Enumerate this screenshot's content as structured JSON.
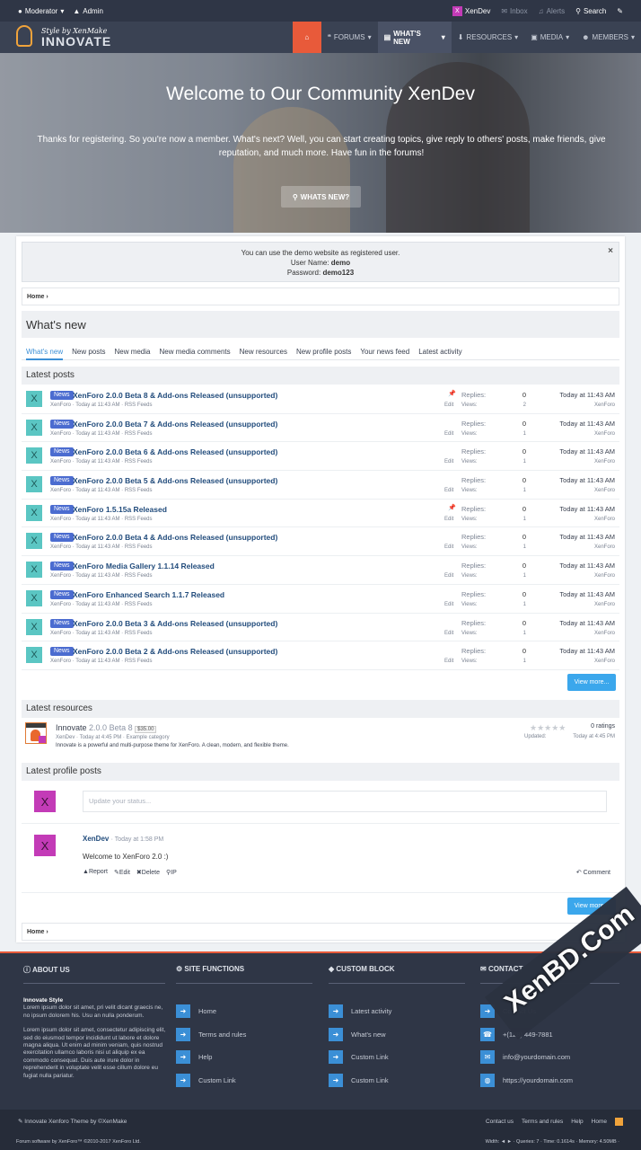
{
  "topbar": {
    "left": [
      {
        "icon": "user-icon",
        "label": "Moderator"
      },
      {
        "icon": "lock-icon",
        "label": "Admin"
      }
    ],
    "user": {
      "avatar": "X",
      "name": "XenDev"
    },
    "inbox": "Inbox",
    "alerts": "Alerts",
    "search": "Search"
  },
  "logo": {
    "tagline": "Style by XenMake",
    "name": "INNOVATE"
  },
  "nav": {
    "home_icon": "home-icon",
    "tabs": [
      "FORUMS",
      "WHAT'S NEW",
      "RESOURCES",
      "MEDIA",
      "MEMBERS"
    ]
  },
  "hero": {
    "title": "Welcome to Our Community XenDev",
    "text": "Thanks for registering. So you're now a member. What's next? Well, you can start creating topics, give reply to others' posts, make friends, give reputation, and much more. Have fun in the forums!",
    "button": "WHATS NEW?"
  },
  "notice": {
    "line1": "You can use the demo website as registered user.",
    "user_label": "User Name:",
    "user_value": "demo",
    "pass_label": "Password:",
    "pass_value": "demo123",
    "close": "×"
  },
  "breadcrumb": {
    "home": "Home",
    "sep": "›"
  },
  "page_title": "What's new",
  "tabs": [
    "What's new",
    "New posts",
    "New media",
    "New media comments",
    "New resources",
    "New profile posts",
    "Your news feed",
    "Latest activity"
  ],
  "latest_posts": {
    "heading": "Latest posts",
    "replies_label": "Replies:",
    "views_label": "Views:",
    "edit_label": "Edit",
    "avatar": "X",
    "badge": "News",
    "items": [
      {
        "title": "XenForo 2.0.0 Beta 8 & Add-ons Released (unsupported)",
        "meta": "XenForo · Today at 11:43 AM · RSS Feeds",
        "pinned": true,
        "replies": "0",
        "views": "2",
        "date": "Today at 11:43 AM",
        "by": "XenForo"
      },
      {
        "title": "XenForo 2.0.0 Beta 7 & Add-ons Released (unsupported)",
        "meta": "XenForo · Today at 11:43 AM · RSS Feeds",
        "pinned": false,
        "replies": "0",
        "views": "1",
        "date": "Today at 11:43 AM",
        "by": "XenForo"
      },
      {
        "title": "XenForo 2.0.0 Beta 6 & Add-ons Released (unsupported)",
        "meta": "XenForo · Today at 11:43 AM · RSS Feeds",
        "pinned": false,
        "replies": "0",
        "views": "1",
        "date": "Today at 11:43 AM",
        "by": "XenForo"
      },
      {
        "title": "XenForo 2.0.0 Beta 5 & Add-ons Released (unsupported)",
        "meta": "XenForo · Today at 11:43 AM · RSS Feeds",
        "pinned": false,
        "replies": "0",
        "views": "1",
        "date": "Today at 11:43 AM",
        "by": "XenForo"
      },
      {
        "title": "XenForo 1.5.15a Released",
        "meta": "XenForo · Today at 11:43 AM · RSS Feeds",
        "pinned": true,
        "replies": "0",
        "views": "1",
        "date": "Today at 11:43 AM",
        "by": "XenForo"
      },
      {
        "title": "XenForo 2.0.0 Beta 4 & Add-ons Released (unsupported)",
        "meta": "XenForo · Today at 11:43 AM · RSS Feeds",
        "pinned": false,
        "replies": "0",
        "views": "1",
        "date": "Today at 11:43 AM",
        "by": "XenForo"
      },
      {
        "title": "XenForo Media Gallery 1.1.14 Released",
        "meta": "XenForo · Today at 11:43 AM · RSS Feeds",
        "pinned": false,
        "replies": "0",
        "views": "1",
        "date": "Today at 11:43 AM",
        "by": "XenForo"
      },
      {
        "title": "XenForo Enhanced Search 1.1.7 Released",
        "meta": "XenForo · Today at 11:43 AM · RSS Feeds",
        "pinned": false,
        "replies": "0",
        "views": "1",
        "date": "Today at 11:43 AM",
        "by": "XenForo"
      },
      {
        "title": "XenForo 2.0.0 Beta 3 & Add-ons Released (unsupported)",
        "meta": "XenForo · Today at 11:43 AM · RSS Feeds",
        "pinned": false,
        "replies": "0",
        "views": "1",
        "date": "Today at 11:43 AM",
        "by": "XenForo"
      },
      {
        "title": "XenForo 2.0.0 Beta 2 & Add-ons Released (unsupported)",
        "meta": "XenForo · Today at 11:43 AM · RSS Feeds",
        "pinned": false,
        "replies": "0",
        "views": "1",
        "date": "Today at 11:43 AM",
        "by": "XenForo"
      }
    ],
    "view_more": "View more..."
  },
  "latest_resources": {
    "heading": "Latest resources",
    "icon_label": "Innovate",
    "name": "Innovate",
    "version": "2.0.0 Beta 8",
    "price": "$35.00",
    "meta": "XenDev · Today at 4:45 PM · Example category",
    "desc": "Innovate is a powerful and multi-purpose theme for XenForo. A clean, modern, and flexible theme.",
    "stars": "★★★★★",
    "rating": 0,
    "ratings": "0 ratings",
    "updated_label": "Updated:",
    "updated_value": "Today at 4:45 PM"
  },
  "profile_posts": {
    "heading": "Latest profile posts",
    "avatar": "X",
    "placeholder": "Update your status...",
    "user": "XenDev",
    "time": "· Today at 1:58 PM",
    "message": "Welcome to XenForo 2.0 :)",
    "actions": [
      "Report",
      "Edit",
      "Delete",
      "IP"
    ],
    "comment": "Comment",
    "view_more": "View more..."
  },
  "footer": {
    "about": {
      "heading": "ABOUT US",
      "title": "Innovate Style",
      "p1": "Lorem ipsum dolor sit amet, pri velit dicant graecis ne, no ipsum dolorem his. Usu an nulla ponderum.",
      "p2": "Lorem ipsum dolor sit amet, consectetur adipiscing elit, sed do eiusmod tempor incididunt ut labore et dolore magna aliqua. Ut enim ad minim veniam, quis nostrud exercitation ullamco laboris nisi ut aliquip ex ea commodo consequat. Duis aute irure dolor in reprehenderit in voluptate velit esse cillum dolore eu fugiat nulla pariatur."
    },
    "site_functions": {
      "heading": "SITE FUNCTIONS",
      "items": [
        "Home",
        "Terms and rules",
        "Help",
        "Custom Link"
      ]
    },
    "custom_block": {
      "heading": "CUSTOM BLOCK",
      "items": [
        "Latest activity",
        "What's new",
        "Custom Link",
        "Custom Link"
      ]
    },
    "contact": {
      "heading": "CONTACT",
      "items": [
        "Contact Us",
        "+(128) 449-7881",
        "info@yourdomain.com",
        "https://yourdomain.com"
      ]
    },
    "theme": "Innovate  Xenforo Theme  by  ©XenMake",
    "links": [
      "Contact us",
      "Terms and rules",
      "Help",
      "Home"
    ],
    "copyright": "Forum software by XenForo™ ©2010-2017 XenForo Ltd.",
    "stats": "Width: ◄ ► · Queries: 7 · Time: 0.1614s · Memory: 4.50MB ·"
  },
  "watermark": "XenBD.Com"
}
